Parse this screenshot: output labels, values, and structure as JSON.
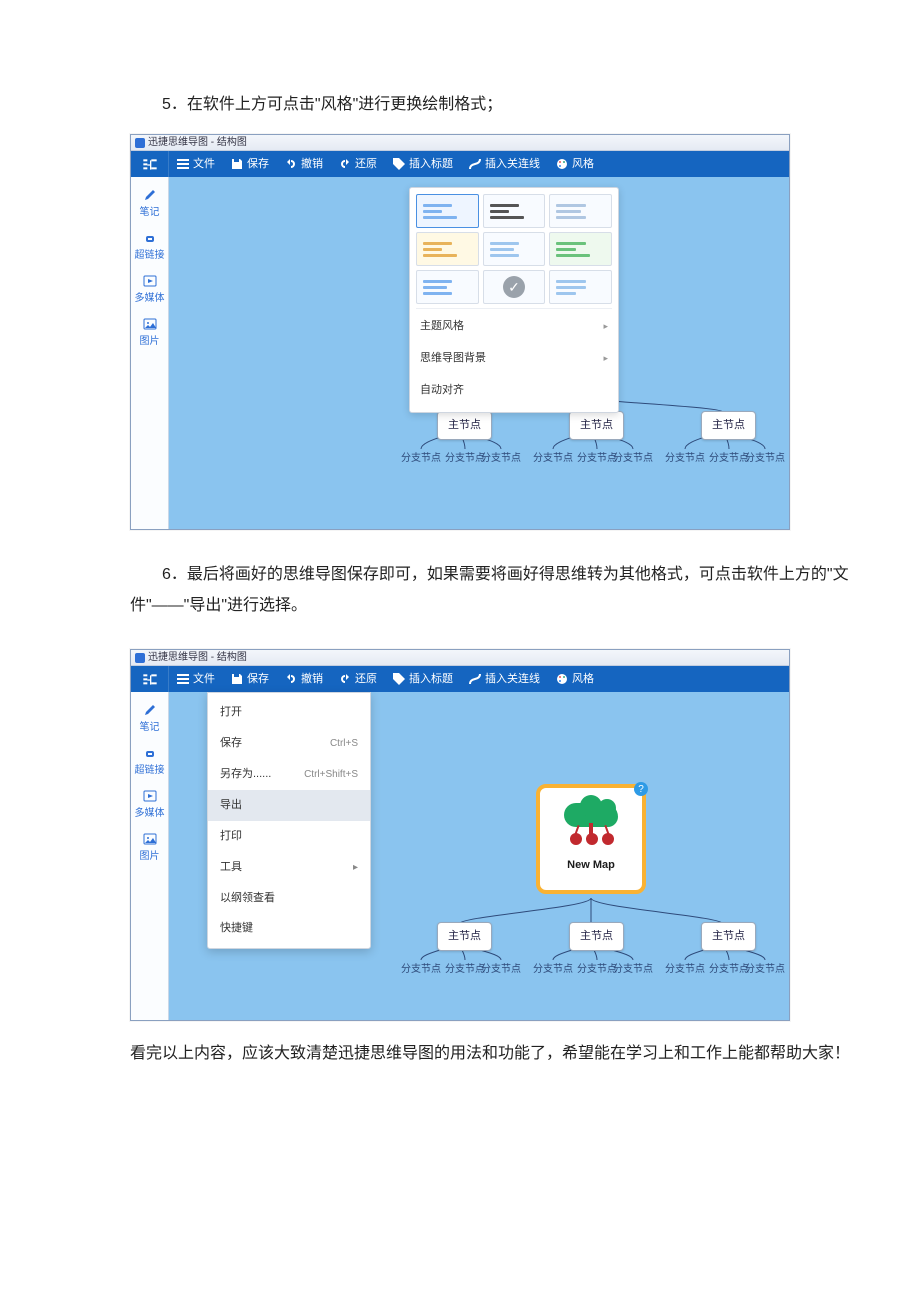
{
  "step5": "5．在软件上方可点击\"风格\"进行更换绘制格式；",
  "step6": "6．最后将画好的思维导图保存即可，如果需要将画好得思维转为其他格式，可点击软件上方的\"文件\"——\"导出\"进行选择。",
  "closing": "看完以上内容，应该大致清楚迅捷思维导图的用法和功能了，希望能在学习上和工作上能都帮助大家！",
  "app": {
    "title": "迅捷思维导图 - 结构图",
    "toolbar": {
      "file": "文件",
      "save": "保存",
      "undo": "撤销",
      "redo": "还原",
      "insTitle": "插入标题",
      "insLink": "插入关连线",
      "style": "风格"
    },
    "side": {
      "note": "笔记",
      "link": "超链接",
      "media": "多媒体",
      "img": "图片"
    }
  },
  "canvas": {
    "rootLabel": "New Map",
    "mainNode": "主节点",
    "subNode": "分支节点"
  },
  "stylePanel": {
    "themeStyle": "主题风格",
    "mapBg": "思维导图背景",
    "autoAlign": "自动对齐"
  },
  "fileMenu": {
    "open": "打开",
    "save": "保存",
    "saveAs": "另存为......",
    "export": "导出",
    "print": "打印",
    "tools": "工具",
    "look": "以纲领查看",
    "shortcut": "快捷键",
    "sh_save": "Ctrl+S",
    "sh_saveAs": "Ctrl+Shift+S"
  }
}
